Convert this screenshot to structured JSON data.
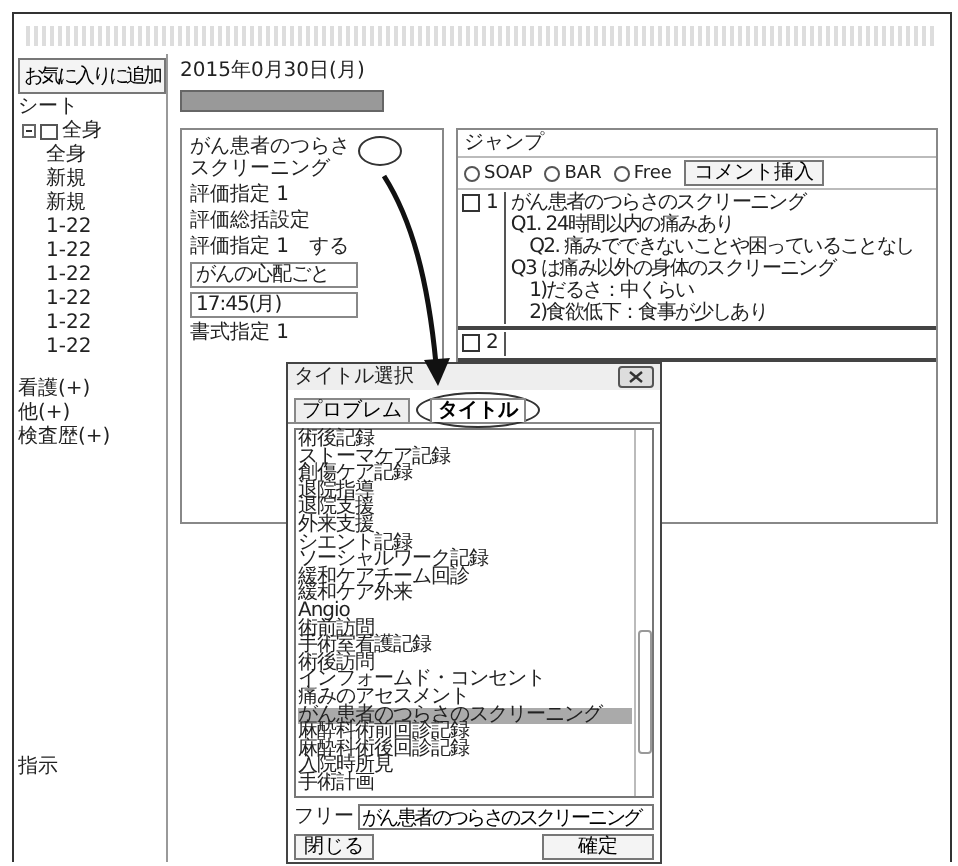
{
  "sidebar": {
    "favorite_button": "お気に入りに追加",
    "sheet_label": "シート",
    "tree": {
      "label": "全身",
      "expanded": true,
      "children": [
        "全身",
        "新規",
        "新規",
        "1-22",
        "1-22",
        "1-22",
        "1-22",
        "1-22",
        "1-22"
      ]
    },
    "sections": [
      "看護(+)",
      "他(+)",
      "検査歴(+)"
    ],
    "footer": "指示"
  },
  "header": {
    "date": "2015年0月30日(月)"
  },
  "form": {
    "title": "がん患者のつらさスクリーニング",
    "fields": [
      {
        "kind": "label",
        "text": "評価指定 1"
      },
      {
        "kind": "label",
        "text": "評価総括設定"
      },
      {
        "kind": "label",
        "text": "評価指定 1　する"
      },
      {
        "kind": "input",
        "text": "がんの心配ごと"
      },
      {
        "kind": "input",
        "text": "17:45(月)"
      },
      {
        "kind": "label",
        "text": "書式指定 1"
      }
    ]
  },
  "editor": {
    "jump": "ジャンプ",
    "modes": [
      {
        "label": "SOAP",
        "selected": false
      },
      {
        "label": "BAR",
        "selected": false
      },
      {
        "label": "Free",
        "selected": false
      }
    ],
    "insert_button": "コメント挿入",
    "entries": [
      {
        "number": "1",
        "checked": false,
        "lines": [
          "がん患者のつらさのスクリーニング",
          "Q1. 24時間以内の痛みあり",
          "　Q2. 痛みでできないことや困っていることなし",
          "Q3 は痛み以外の身体のスクリーニング",
          "　1)だるさ：中くらい",
          "　2)食欲低下：食事が少しあり"
        ]
      },
      {
        "number": "2",
        "checked": false
      }
    ]
  },
  "dialog": {
    "title": "タイトル選択",
    "tabs": [
      {
        "label": "プロブレム",
        "selected": false
      },
      {
        "label": "タイトル",
        "selected": true
      }
    ],
    "items": [
      {
        "label": "術後記録",
        "selected": false
      },
      {
        "label": "ストーマケア記録",
        "selected": false
      },
      {
        "label": "創傷ケア記録",
        "selected": false
      },
      {
        "label": "退院指導",
        "selected": false
      },
      {
        "label": "退院支援",
        "selected": false
      },
      {
        "label": "外来支援",
        "selected": false
      },
      {
        "label": "シエント記録",
        "selected": false
      },
      {
        "label": "ソーシャルワーク記録",
        "selected": false
      },
      {
        "label": "緩和ケアチーム回診",
        "selected": false
      },
      {
        "label": "緩和ケア外来",
        "selected": false
      },
      {
        "label": "Angio",
        "selected": false
      },
      {
        "label": "術前訪問",
        "selected": false
      },
      {
        "label": "手術室看護記録",
        "selected": false
      },
      {
        "label": "術後訪問",
        "selected": false
      },
      {
        "label": "インフォームド・コンセント",
        "selected": false
      },
      {
        "label": "痛みのアセスメント",
        "selected": false
      },
      {
        "label": "がん患者のつらさのスクリーニング",
        "selected": true
      },
      {
        "label": "麻酔科術前回診記録",
        "selected": false
      },
      {
        "label": "麻酔科術後回診記録",
        "selected": false
      },
      {
        "label": "入院時所見",
        "selected": false
      },
      {
        "label": "手術計画",
        "selected": false
      }
    ],
    "free_label": "フリー",
    "free_value": "がん患者のつらさのスクリーニング",
    "buttons": [
      {
        "kind": "close",
        "label": "閉じる"
      },
      {
        "kind": "confirm",
        "label": "確定"
      }
    ]
  }
}
